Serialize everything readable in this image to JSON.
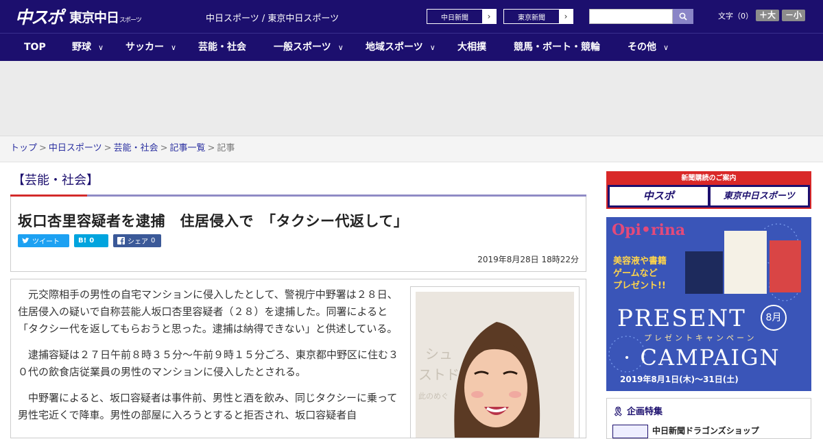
{
  "header": {
    "logo_chuspo": "中スポ",
    "logo_tokyo": "東京中日",
    "logo_tokyo_small": "スポーツ",
    "tagline": "中日スポーツ / 東京中日スポーツ",
    "paper_links": [
      "中日新聞",
      "東京新聞"
    ],
    "font_size_label": "文字（0）",
    "font_plus": "＋大",
    "font_minus": "－小"
  },
  "nav": {
    "items": [
      {
        "label": "TOP",
        "has_menu": false
      },
      {
        "label": "野球",
        "has_menu": true
      },
      {
        "label": "サッカー",
        "has_menu": true
      },
      {
        "label": "芸能・社会",
        "has_menu": false
      },
      {
        "label": "一般スポーツ",
        "has_menu": true
      },
      {
        "label": "地域スポーツ",
        "has_menu": true
      },
      {
        "label": "大相撲",
        "has_menu": false
      },
      {
        "label": "競馬・ボート・競輪",
        "has_menu": false
      },
      {
        "label": "その他",
        "has_menu": true
      }
    ]
  },
  "breadcrumb": [
    "トップ",
    "中日スポーツ",
    "芸能・社会",
    "記事一覧",
    "記事"
  ],
  "article": {
    "category": "【芸能・社会】",
    "title": "坂口杏里容疑者を逮捕　住居侵入で　「タクシー代返して」",
    "tweet_label": "ツイート",
    "hatena_label": "B!",
    "hatena_count": "0",
    "share_label": "シェア",
    "share_count": "0",
    "date": "2019年8月28日 18時22分",
    "paragraphs": [
      "元交際相手の男性の自宅マンションに侵入したとして、警視庁中野署は２８日、住居侵入の疑いで自称芸能人坂口杏里容疑者（２８）を逮捕した。同署によると「タクシー代を返してもらおうと思った。逮捕は納得できない」と供述している。",
      "逮捕容疑は２７日午前８時３５分～午前９時１５分ごろ、東京都中野区に住む３０代の飲食店従業員の男性のマンションに侵入したとされる。",
      "中野署によると、坂口容疑者は事件前、男性と酒を飲み、同じタクシーに乗って男性宅近くで降車。男性の部屋に入ろうとすると拒否され、坂口容疑者自"
    ]
  },
  "sidebar": {
    "subscribe_top": "新聞購読のご案内",
    "subscribe_logos": [
      "中スポ",
      "東京中日スポーツ"
    ],
    "present": {
      "brand": "Opi•rina",
      "promo": "美容液や書籍\nゲームなど\nプレゼント!!",
      "title1": "PRESENT",
      "subtitle": "プレゼントキャンペーン",
      "title2": "· CAMPAIGN",
      "month": "8月",
      "dates": "2019年8月1日(木)〜31日(土)"
    },
    "kikaku_title": "企画特集",
    "kikaku_item": "中日新聞ドラゴンズショップ"
  },
  "colors": {
    "brand_navy": "#1c0f6e",
    "accent_red": "#d32a2a",
    "twitter": "#1da1f2",
    "hatena": "#00a4de",
    "facebook": "#3b5998"
  }
}
